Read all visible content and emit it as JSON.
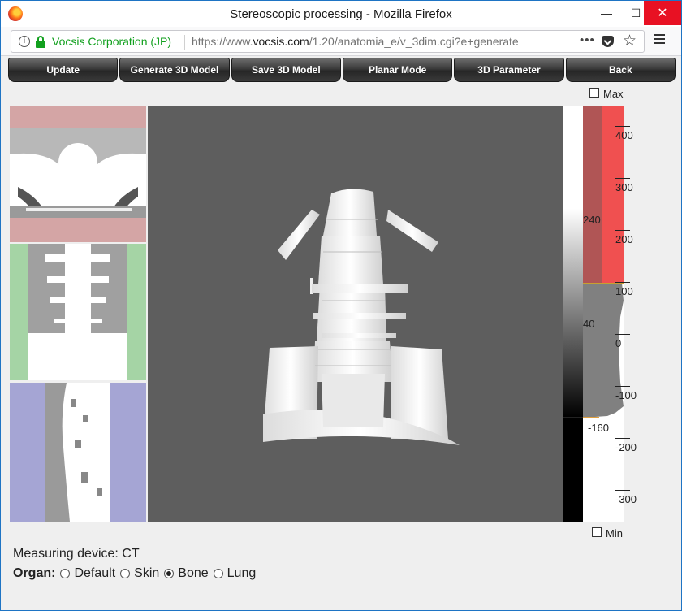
{
  "window": {
    "title": "Stereoscopic processing - Mozilla Firefox",
    "minimize_glyph": "—",
    "maximize_glyph": "☐",
    "close_glyph": "✕"
  },
  "browser": {
    "site_identity": "Vocsis Corporation (JP)",
    "url_prefix": "https://www.",
    "url_domain": "vocsis.com",
    "url_path": "/1.20/anatomia_e/v_3dim.cgi?e+generate",
    "more_glyph": "•••",
    "star_glyph": "☆",
    "info_glyph": "i"
  },
  "toolbar": {
    "buttons": [
      "Update",
      "Generate 3D Model",
      "Save 3D Model",
      "Planar Mode",
      "3D Parameter",
      "Back"
    ]
  },
  "controls": {
    "max_label": "Max",
    "min_label": "Min",
    "max_checked": false,
    "min_checked": false
  },
  "scale": {
    "ticks": [
      "400",
      "300",
      "200",
      "100",
      "0",
      "-100",
      "-200",
      "-300"
    ],
    "window_level_labels": [
      "240",
      "40",
      "-160"
    ]
  },
  "info": {
    "measuring_device": "Measuring device: CT",
    "organ_label": "Organ:",
    "organ_options": [
      "Default",
      "Skin",
      "Bone",
      "Lung"
    ],
    "organ_selected": "Bone"
  },
  "colors": {
    "axial_tint": "#d4a5a5",
    "coronal_tint": "#a5d4a5",
    "sagittal_tint": "#a5a5d4",
    "view_bg": "#5e5e5e",
    "hist_window": "#b05555",
    "hist_bright": "#f05050"
  }
}
